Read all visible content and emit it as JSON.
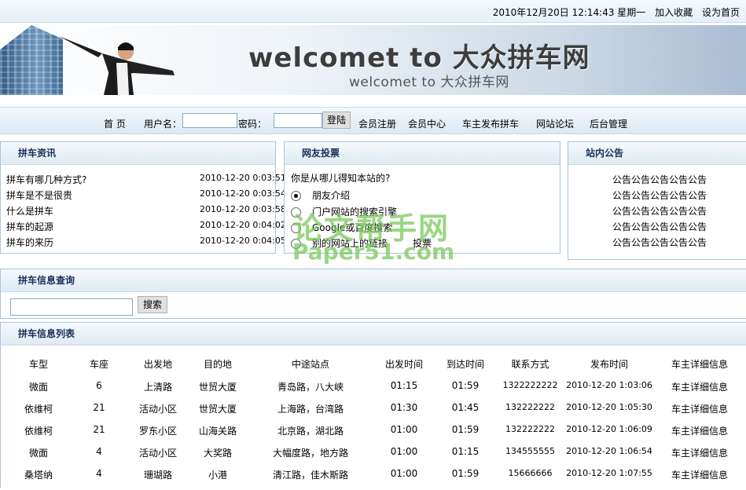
{
  "topbar": {
    "datetime": "2010年12月20日 12:14:43 星期一",
    "add_favorite": "加入收藏",
    "set_homepage": "设为首页"
  },
  "banner": {
    "title_large": "welcomet to 大众拼车网",
    "title_small": "welcomet to 大众拼车网"
  },
  "nav": {
    "home": "首 页",
    "username_label": "用户名：",
    "password_label": "密码：",
    "login_button": "登陆",
    "register": "会员注册",
    "member_center": "会员中心",
    "publish_ride": "车主发布拼车",
    "forum": "网站论坛",
    "admin": "后台管理"
  },
  "news": {
    "title": "拼车资讯",
    "items": [
      {
        "title": "拼车有哪几种方式?",
        "date": "2010-12-20 0:03:51"
      },
      {
        "title": "拼车是不是很贵",
        "date": "2010-12-20 0:03:54"
      },
      {
        "title": "什么是拼车",
        "date": "2010-12-20 0:03:58"
      },
      {
        "title": "拼车的起源",
        "date": "2010-12-20 0:04:02"
      },
      {
        "title": "拼车的来历",
        "date": "2010-12-20 0:04:05"
      }
    ]
  },
  "poll": {
    "title": "网友投票",
    "question": "你是从哪儿得知本站的?",
    "options": [
      "朋友介绍",
      "门户网站的搜索引擎",
      "Google或百度搜索",
      "别的网站上的链接"
    ],
    "vote_button": "投票"
  },
  "notice": {
    "title": "站内公告",
    "items": [
      "公告公告公告公告公告",
      "公告公告公告公告公告",
      "公告公告公告公告公告",
      "公告公告公告公告公告",
      "公告公告公告公告公告"
    ]
  },
  "watermark": {
    "line1": "论文帮手网",
    "line2": "Paper51.com"
  },
  "search": {
    "title": "拼车信息查询",
    "button": "搜索"
  },
  "listing": {
    "title": "拼车信息列表",
    "columns": [
      "车型",
      "车座",
      "出发地",
      "目的地",
      "中途站点",
      "出发时间",
      "到达时间",
      "联系方式",
      "发布时间",
      "车主详细信息"
    ],
    "rows": [
      [
        "微面",
        "6",
        "上清路",
        "世贸大厦",
        "青岛路，八大峡",
        "01:15",
        "01:59",
        "1322222222",
        "2010-12-20 1:03:06",
        "车主详细信息"
      ],
      [
        "依维柯",
        "21",
        "活动小区",
        "世贸大厦",
        "上海路，台湾路",
        "01:30",
        "01:45",
        "132222222",
        "2010-12-20 1:05:30",
        "车主详细信息"
      ],
      [
        "依维柯",
        "21",
        "罗东小区",
        "山海关路",
        "北京路，湖北路",
        "01:00",
        "01:59",
        "132222222",
        "2010-12-20 1:06:09",
        "车主详细信息"
      ],
      [
        "微面",
        "4",
        "活动小区",
        "大奖路",
        "大幅度路，地方路",
        "01:00",
        "01:15",
        "134555555",
        "2010-12-20 1:06:54",
        "车主详细信息"
      ],
      [
        "桑塔纳",
        "4",
        "珊瑚路",
        "小港",
        "清江路，佳木斯路",
        "01:00",
        "01:59",
        "15666666",
        "2010-12-20 1:07:55",
        "车主详细信息"
      ]
    ]
  }
}
